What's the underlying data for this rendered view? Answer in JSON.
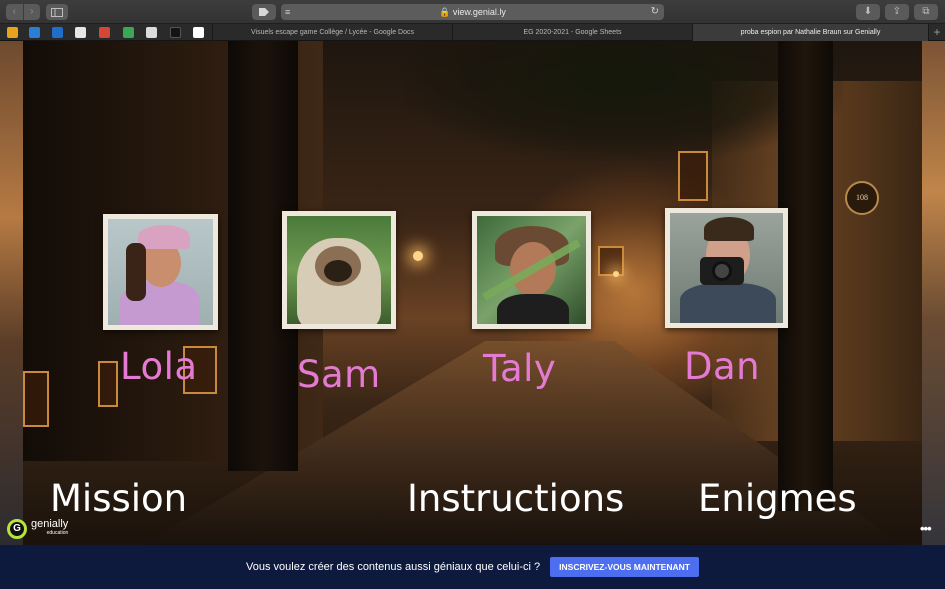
{
  "browser": {
    "url": "view.genial.ly",
    "icons": {
      "back": "chevron-left-icon",
      "forward": "chevron-right-icon",
      "sidebar": "sidebar-icon",
      "tag": "tag-icon",
      "reader": "reader-icon",
      "lock": "lock-icon",
      "reload": "reload-icon",
      "download": "download-icon",
      "share": "share-icon",
      "tabs": "tabs-icon"
    },
    "tabs": [
      {
        "label": "Visuels escape game Collège / Lycée - Google Docs",
        "active": false
      },
      {
        "label": "EG 2020-2021 - Google Sheets",
        "active": false
      },
      {
        "label": "proba espion par Nathalie Braun sur Genially",
        "active": true
      }
    ],
    "new_tab": "+"
  },
  "characters": [
    {
      "name": "Lola"
    },
    {
      "name": "Sam"
    },
    {
      "name": "Taly"
    },
    {
      "name": "Dan"
    }
  ],
  "menu": {
    "mission": "Mission",
    "instructions": "Instructions",
    "enigmes": "Enigmes"
  },
  "sign": "108",
  "genially": {
    "logo": "genially",
    "sub": "education",
    "more": "•••"
  },
  "banner": {
    "message": "Vous voulez créer des contenus aussi géniaux que celui-ci ?",
    "cta": "INSCRIVEZ-VOUS MAINTENANT"
  },
  "colors": {
    "name_pink": "#e47ad2",
    "banner_bg": "#0d1a3e",
    "cta_bg": "#4d6ef0"
  }
}
